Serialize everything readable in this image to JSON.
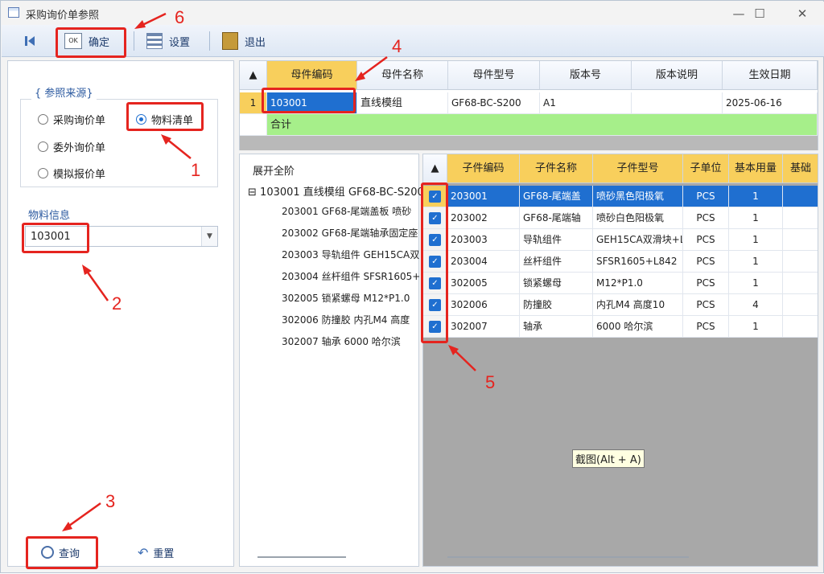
{
  "window": {
    "title": "采购询价单参照",
    "minimize": "—",
    "maximize": "☐",
    "close": "✕"
  },
  "toolbar": {
    "confirm_label": "确定",
    "settings_label": "设置",
    "exit_label": "退出",
    "confirm_icon_text": "OK"
  },
  "left": {
    "group_title": "{ 参照来源}",
    "radios": [
      {
        "label": "采购询价单",
        "checked": false
      },
      {
        "label": "物料清单",
        "checked": true
      },
      {
        "label": "委外询价单",
        "checked": false
      },
      {
        "label": "模拟报价单",
        "checked": false
      }
    ],
    "material_label": "物料信息",
    "material_value": "103001",
    "query_label": "查询",
    "reset_label": "重置"
  },
  "parent_grid": {
    "columns": [
      "母件编码",
      "母件名称",
      "母件型号",
      "版本号",
      "版本说明",
      "生效日期"
    ],
    "rows": [
      {
        "no": "1",
        "code": "103001",
        "name": "直线模组",
        "model": "GF68-BC-S200",
        "version": "A1",
        "desc": "",
        "date": "2025-06-16"
      }
    ],
    "total_label": "合计"
  },
  "tree": {
    "root_label": "展开全阶",
    "parent": "103001 直线模组 GF68-BC-S200",
    "children": [
      "203001 GF68-尾端盖板 喷砂",
      "203002 GF68-尾端轴承固定座",
      "203003 导轨组件 GEH15CA双",
      "203004 丝杆组件 SFSR1605+",
      "302005 锁紧螺母 M12*P1.0",
      "302006 防撞胶 内孔M4 高度",
      "302007 轴承 6000 哈尔滨"
    ]
  },
  "child_grid": {
    "columns": [
      "子件编码",
      "子件名称",
      "子件型号",
      "子单位",
      "基本用量",
      "基础"
    ],
    "rows": [
      {
        "code": "203001",
        "name": "GF68-尾端盖",
        "model": "喷砂黑色阳极氧",
        "unit": "PCS",
        "qty": "1",
        "checked": true
      },
      {
        "code": "203002",
        "name": "GF68-尾端轴",
        "model": "喷砂白色阳极氧",
        "unit": "PCS",
        "qty": "1",
        "checked": true
      },
      {
        "code": "203003",
        "name": "导轨组件",
        "model": "GEH15CA双滑块+L",
        "unit": "PCS",
        "qty": "1",
        "checked": true
      },
      {
        "code": "203004",
        "name": "丝杆组件",
        "model": "SFSR1605+L842",
        "unit": "PCS",
        "qty": "1",
        "checked": true
      },
      {
        "code": "302005",
        "name": "锁紧螺母",
        "model": "M12*P1.0",
        "unit": "PCS",
        "qty": "1",
        "checked": true
      },
      {
        "code": "302006",
        "name": "防撞胶",
        "model": "内孔M4 高度10",
        "unit": "PCS",
        "qty": "4",
        "checked": true
      },
      {
        "code": "302007",
        "name": "轴承",
        "model": "6000 哈尔滨",
        "unit": "PCS",
        "qty": "1",
        "checked": true
      }
    ]
  },
  "tooltip": "截图(Alt + A)",
  "annotations": [
    "1",
    "2",
    "3",
    "4",
    "5",
    "6"
  ],
  "colors": {
    "highlight": "#f8cf5c",
    "total_row": "#a6ef8a",
    "selected_row": "#1f6fd0",
    "annotation": "#e5241f"
  }
}
